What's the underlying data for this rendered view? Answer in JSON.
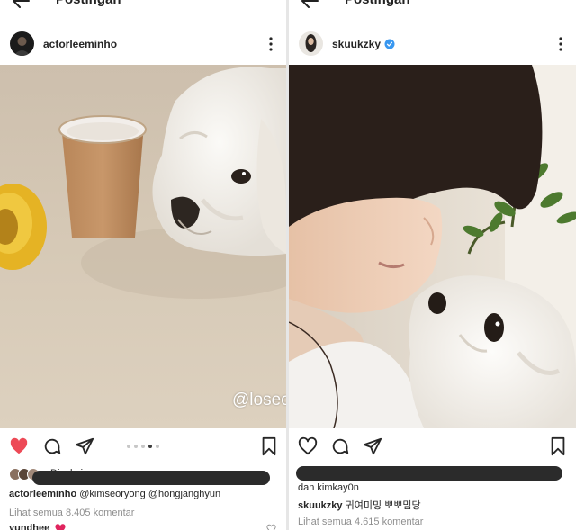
{
  "left_post": {
    "topbar_title": "Postingan",
    "username": "actorleeminho",
    "watermark": "@loseoflove_",
    "likes_prefix": "Disukai",
    "caption_user": "actorleeminho",
    "caption_text": "@kimseoryong @hongjanghyun",
    "view_comments": "Lihat semua 8.405 komentar",
    "comment_user": "yundhee",
    "liked": true,
    "carousel_total": 5,
    "carousel_active": 4
  },
  "right_post": {
    "topbar_title": "Postingan",
    "username": "skuukzky",
    "verified": true,
    "likes_suffix": "dan kimkay0n",
    "caption_user": "skuukzky",
    "caption_text": "귀여미밍 뽀뽀밈당",
    "view_comments": "Lihat semua 4.615 komentar"
  },
  "icons": [
    "back-arrow-icon",
    "more-icon",
    "heart-icon",
    "comment-icon",
    "share-icon",
    "bookmark-icon",
    "verified-badge-icon"
  ],
  "colors": {
    "like_red": "#ed4956",
    "verified_blue": "#3897f0",
    "muted": "#8e8e8e"
  }
}
